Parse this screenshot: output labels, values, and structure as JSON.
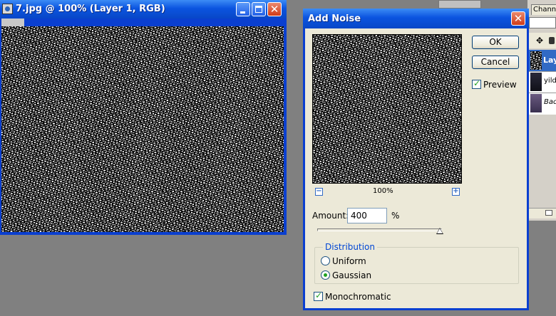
{
  "document_window": {
    "title": "7.jpg @ 100% (Layer 1, RGB)"
  },
  "side_panel": {
    "channels_tab": "Channel",
    "layers": [
      {
        "label": "Lay"
      },
      {
        "label": "yildi"
      },
      {
        "label": "Bac"
      }
    ]
  },
  "dialog": {
    "title": "Add Noise",
    "ok_label": "OK",
    "cancel_label": "Cancel",
    "preview_label": "Preview",
    "preview_checked": true,
    "zoom_out": "−",
    "zoom_in": "+",
    "zoom_level": "100%",
    "amount_label": "Amount:",
    "amount_value": "400",
    "amount_unit": "%",
    "distribution": {
      "legend": "Distribution",
      "options": [
        {
          "label": "Uniform",
          "selected": false
        },
        {
          "label": "Gaussian",
          "selected": true
        }
      ]
    },
    "monochromatic_label": "Monochromatic",
    "monochromatic_checked": true
  }
}
